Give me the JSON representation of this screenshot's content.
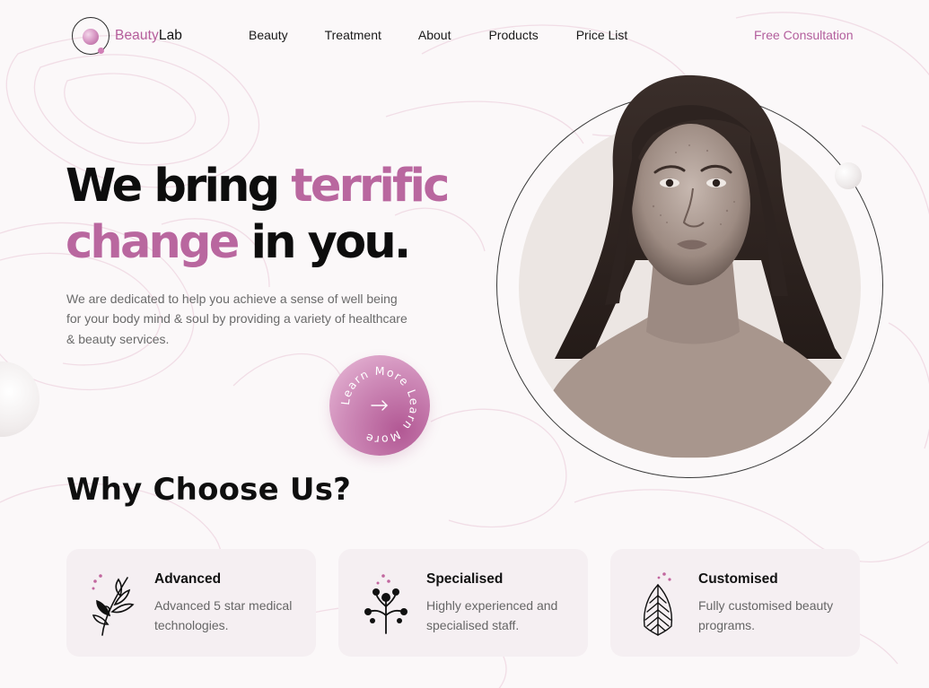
{
  "brand": {
    "name_accent": "Beauty",
    "name_rest": "Lab"
  },
  "nav": {
    "items": [
      "Beauty",
      "Treatment",
      "About",
      "Products",
      "Price List"
    ],
    "cta": "Free Consultation"
  },
  "hero": {
    "title_dark_1": "We bring ",
    "title_accent_1": "terrific",
    "title_accent_2": "change",
    "title_dark_2": " in you.",
    "description": "We are dedicated to help you achieve a sense of well being for your body mind & soul by providing a variety of healthcare & beauty services.",
    "learn_more_ring_text": "Learn More Learn More"
  },
  "why": {
    "title": "Why Choose Us?",
    "cards": [
      {
        "icon": "leafy-branch-icon",
        "title": "Advanced",
        "text": "Advanced 5 star medical technologies."
      },
      {
        "icon": "berry-sprig-icon",
        "title": "Specialised",
        "text": "Highly experienced and specialised staff."
      },
      {
        "icon": "fern-leaf-icon",
        "title": "Customised",
        "text": "Fully customised beauty programs."
      }
    ]
  },
  "colors": {
    "accent": "#b9679f",
    "background": "#fbf8f9",
    "card": "#f5eff2"
  }
}
